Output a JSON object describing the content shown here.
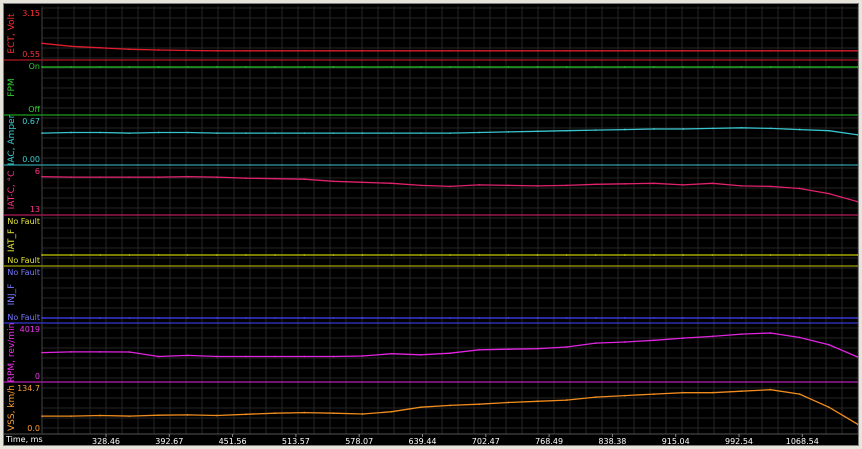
{
  "title": "",
  "channels": [
    {
      "id": "ect",
      "label": "ECT, Volt",
      "color": "#ff3030",
      "line": "#e11c2c",
      "tick_color": "#ff3030",
      "top_label": "3.15",
      "bottom_label": "0.55"
    },
    {
      "id": "fpm",
      "label": "FPM",
      "color": "#33d033",
      "line": "#22c422",
      "tick_color": "#33d033",
      "top_label": "On",
      "bottom_label": "Off"
    },
    {
      "id": "iac",
      "label": "IAC, Amper",
      "color": "#3ad0d8",
      "line": "#39c5ce",
      "tick_color": "#3ad0d8",
      "top_label": "0.67",
      "bottom_label": "0.00"
    },
    {
      "id": "iat",
      "label": "IAT-C, °C",
      "color": "#ff3388",
      "line": "#e0226e",
      "tick_color": "#ff3388",
      "top_label": "6",
      "bottom_label": "13"
    },
    {
      "id": "iatf",
      "label": "IAT_F",
      "color": "#e6e63a",
      "line": "#c8c800",
      "tick_color": "#e6e63a",
      "top_label": "No Fault",
      "bottom_label": "No Fault"
    },
    {
      "id": "injf",
      "label": "INJ_F",
      "color": "#7777ff",
      "line": "#4444ff",
      "tick_color": "#7777ff",
      "top_label": "No Fault",
      "bottom_label": "No Fault"
    },
    {
      "id": "rpm",
      "label": "RPM, rev/min",
      "color": "#ee33ee",
      "line": "#e024e0",
      "tick_color": "#ee33ee",
      "top_label": "4019",
      "bottom_label": "0"
    },
    {
      "id": "vss",
      "label": "VSS, km/h",
      "color": "#ffa030",
      "line": "#f08c1e",
      "tick_color": "#ffa030",
      "top_label": "134.7",
      "bottom_label": "0.0"
    }
  ],
  "x_axis": {
    "label": "Time, ms",
    "ticks": [
      "328.46",
      "392.67",
      "451.56",
      "513.57",
      "578.07",
      "639.44",
      "702.47",
      "768.49",
      "838.38",
      "915.04",
      "992.54",
      "1068.54",
      "11"
    ]
  },
  "chart_data": {
    "type": "line",
    "x": [
      270,
      300,
      330,
      360,
      390,
      420,
      450,
      480,
      510,
      540,
      570,
      600,
      630,
      660,
      690,
      720,
      750,
      780,
      810,
      840,
      870,
      900,
      930,
      960,
      990,
      1020,
      1050,
      1080,
      1110
    ],
    "series": [
      {
        "name": "ECT, Volt",
        "ylim": [
          0.55,
          3.15
        ],
        "values": [
          1.2,
          1.0,
          0.9,
          0.8,
          0.75,
          0.72,
          0.7,
          0.7,
          0.7,
          0.7,
          0.7,
          0.7,
          0.7,
          0.7,
          0.7,
          0.7,
          0.7,
          0.7,
          0.7,
          0.7,
          0.7,
          0.7,
          0.7,
          0.7,
          0.7,
          0.7,
          0.7,
          0.7,
          0.7
        ]
      },
      {
        "name": "FPM",
        "ylim": [
          0,
          1
        ],
        "values": [
          1,
          1,
          1,
          1,
          1,
          1,
          1,
          1,
          1,
          1,
          1,
          1,
          1,
          1,
          1,
          1,
          1,
          1,
          1,
          1,
          1,
          1,
          1,
          1,
          1,
          1,
          1,
          1,
          1
        ]
      },
      {
        "name": "IAC, Amper",
        "ylim": [
          0,
          0.67
        ],
        "values": [
          0.45,
          0.46,
          0.46,
          0.45,
          0.46,
          0.46,
          0.45,
          0.45,
          0.45,
          0.45,
          0.45,
          0.45,
          0.45,
          0.45,
          0.45,
          0.46,
          0.47,
          0.48,
          0.49,
          0.5,
          0.51,
          0.52,
          0.52,
          0.53,
          0.54,
          0.53,
          0.51,
          0.49,
          0.42
        ]
      },
      {
        "name": "IAT-C, °C",
        "ylim": [
          6,
          13
        ],
        "values": [
          6.9,
          7.0,
          7.0,
          7.0,
          7.0,
          6.9,
          7.0,
          7.2,
          7.3,
          7.4,
          7.8,
          8.0,
          8.2,
          8.6,
          8.8,
          8.5,
          8.6,
          8.7,
          8.6,
          8.4,
          8.3,
          8.2,
          8.5,
          8.2,
          8.7,
          8.8,
          9.2,
          10.2,
          11.8
        ]
      },
      {
        "name": "IAT_F",
        "ylim": [
          0,
          1
        ],
        "values": [
          0,
          0,
          0,
          0,
          0,
          0,
          0,
          0,
          0,
          0,
          0,
          0,
          0,
          0,
          0,
          0,
          0,
          0,
          0,
          0,
          0,
          0,
          0,
          0,
          0,
          0,
          0,
          0,
          0
        ]
      },
      {
        "name": "INJ_F",
        "ylim": [
          0,
          1
        ],
        "values": [
          0,
          0,
          0,
          0,
          0,
          0,
          0,
          0,
          0,
          0,
          0,
          0,
          0,
          0,
          0,
          0,
          0,
          0,
          0,
          0,
          0,
          0,
          0,
          0,
          0,
          0,
          0,
          0,
          0
        ]
      },
      {
        "name": "RPM, rev/min",
        "ylim": [
          0,
          4019
        ],
        "values": [
          2000,
          2060,
          2060,
          2050,
          1650,
          1750,
          1650,
          1650,
          1650,
          1650,
          1650,
          1700,
          1900,
          1800,
          1950,
          2250,
          2300,
          2350,
          2500,
          2850,
          2950,
          3100,
          3300,
          3450,
          3650,
          3750,
          3350,
          2700,
          1600
        ]
      },
      {
        "name": "VSS, km/h",
        "ylim": [
          0,
          134.7
        ],
        "values": [
          40,
          40,
          42,
          40,
          43,
          44,
          42,
          46,
          50,
          52,
          50,
          47,
          55,
          70,
          76,
          80,
          86,
          90,
          94,
          104,
          109,
          114,
          119,
          119,
          124,
          129,
          114,
          70,
          12
        ]
      }
    ]
  }
}
